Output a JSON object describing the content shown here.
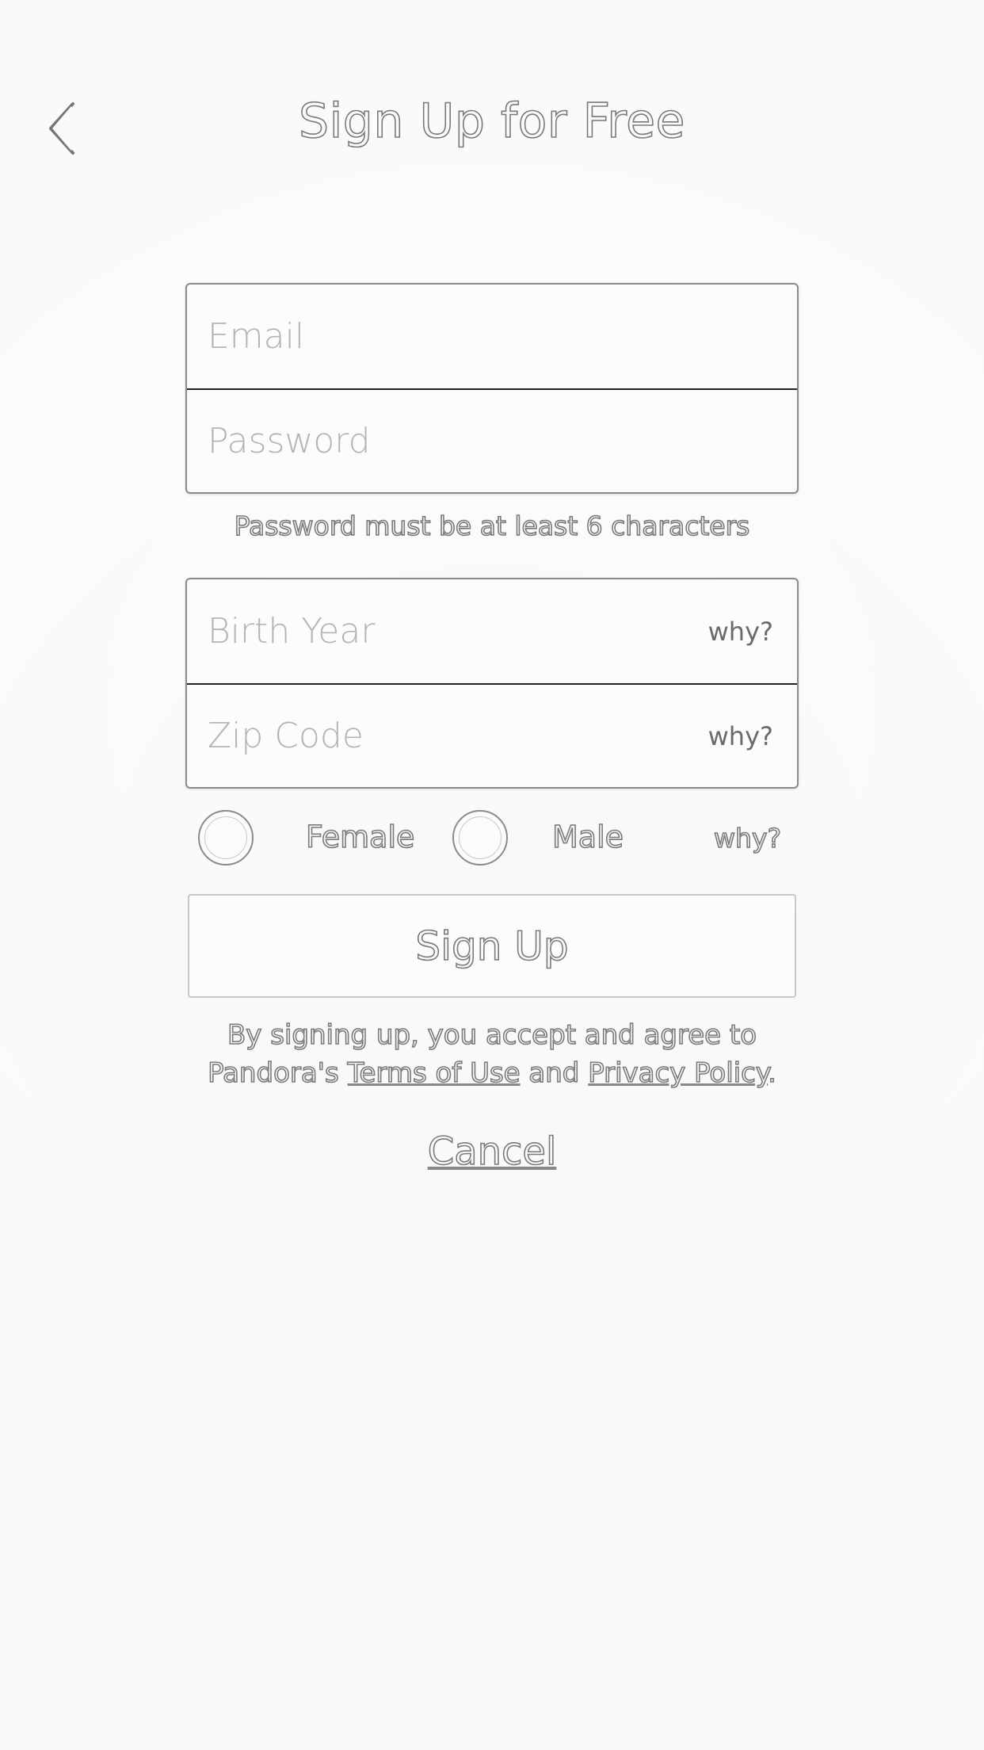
{
  "header": {
    "back_icon": "chevron-left-icon",
    "title": "Sign Up for Free"
  },
  "account_fields": {
    "email_placeholder": "Email",
    "password_placeholder": "Password"
  },
  "password_hint": "Password must be at least 6 characters",
  "profile_fields": {
    "birth_year_placeholder": "Birth Year",
    "birth_year_why": "why?",
    "zip_code_placeholder": "Zip Code",
    "zip_code_why": "why?"
  },
  "gender": {
    "female_label": "Female",
    "male_label": "Male",
    "why": "why?"
  },
  "signup_button_label": "Sign Up",
  "terms": {
    "line1": "By signing up, you accept and agree to",
    "prefix": "Pandora's ",
    "terms_link": "Terms of Use",
    "and": " and ",
    "privacy_link": "Privacy Policy",
    "suffix": "."
  },
  "cancel_label": "Cancel",
  "colors": {
    "background": "#fafafa",
    "outline_text": "#7a7a7a",
    "placeholder": "#b4b4b4"
  }
}
